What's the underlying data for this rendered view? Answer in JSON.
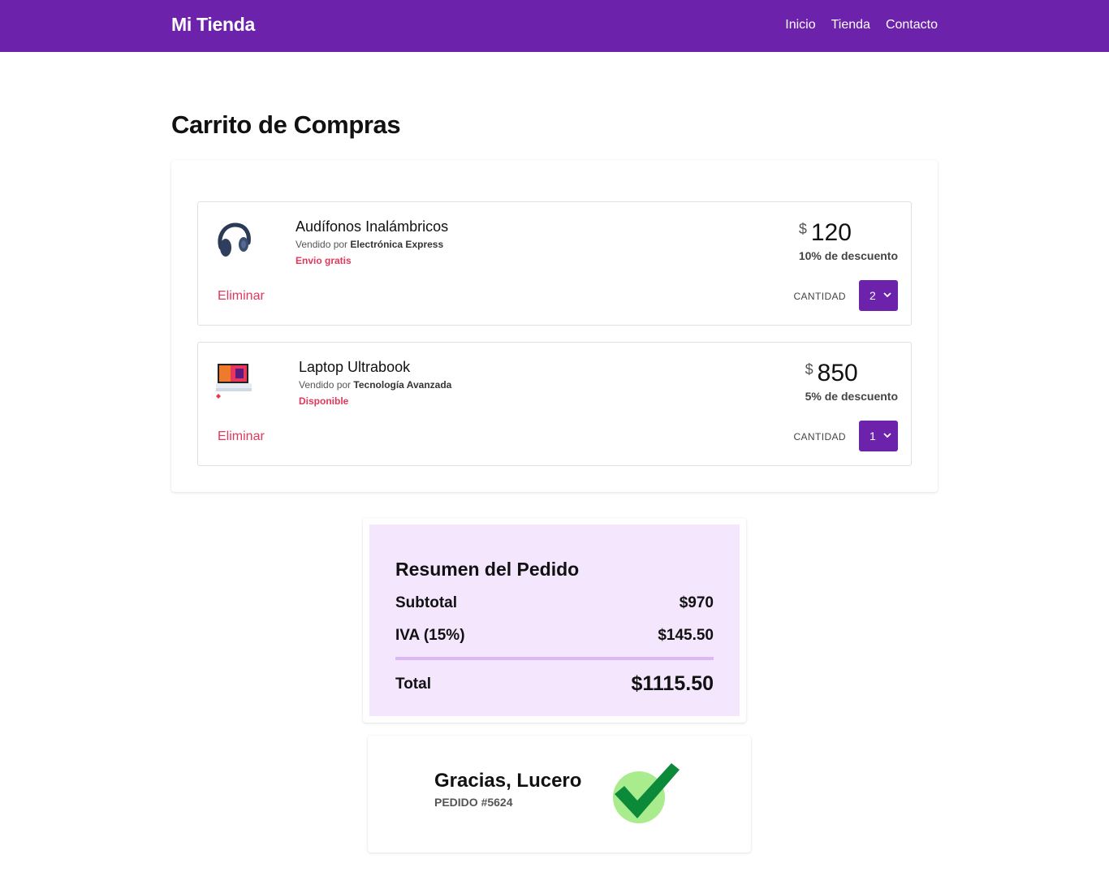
{
  "header": {
    "brand": "Mi Tienda",
    "nav": [
      "Inicio",
      "Tienda",
      "Contacto"
    ]
  },
  "page_title": "Carrito de Compras",
  "cart": {
    "items": [
      {
        "name": "Audífonos Inalámbricos",
        "seller_prefix": "Vendido por",
        "seller": "Electrónica Express",
        "shipping": "Envio gratis",
        "remove_label": "Eliminar",
        "currency": "$",
        "price": "120",
        "discount": "10% de descuento",
        "qty_label": "CANTIDAD",
        "qty": "2",
        "icon": "headphones-icon"
      },
      {
        "name": "Laptop Ultrabook",
        "seller_prefix": "Vendido por",
        "seller": "Tecnología Avanzada",
        "shipping": "Disponible",
        "remove_label": "Eliminar",
        "currency": "$",
        "price": "850",
        "discount": "5% de descuento",
        "qty_label": "CANTIDAD",
        "qty": "1",
        "icon": "laptop-icon"
      }
    ]
  },
  "summary": {
    "title": "Resumen del Pedido",
    "subtotal_label": "Subtotal",
    "subtotal": "$970",
    "iva_label": "IVA (15%)",
    "iva": "$145.50",
    "total_label": "Total",
    "total": "$1115.50"
  },
  "confirmation": {
    "title": "Gracias, Lucero",
    "order": "PEDIDO #5624",
    "icon": "checkmark-icon"
  },
  "colors": {
    "primary": "#6d22ab",
    "accent_red": "#e0385c",
    "summary_bg": "#f3e6fd",
    "check_green": "#0b8a3a",
    "check_circle": "#a8ec8e"
  }
}
